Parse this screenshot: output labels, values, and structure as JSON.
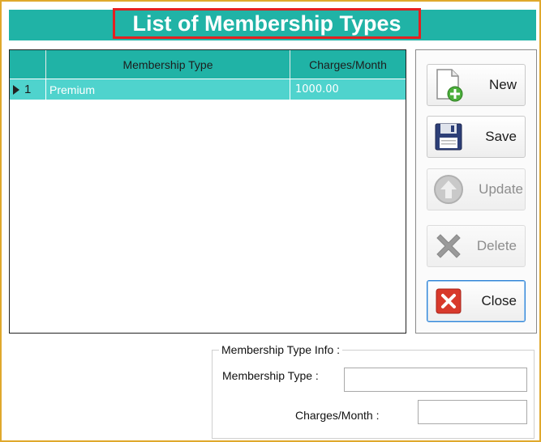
{
  "title": "List of Membership Types",
  "grid": {
    "columns": [
      "Membership Type",
      "Charges/Month"
    ],
    "rows": [
      {
        "index": "1",
        "membership_type": "Premium",
        "charges": "1000.00"
      }
    ]
  },
  "buttons": {
    "new": "New",
    "save": "Save",
    "update": "Update",
    "delete": "Delete",
    "close": "Close"
  },
  "info": {
    "legend": "Membership Type Info :",
    "type_label": "Membership Type :",
    "type_value": "",
    "charges_label": "Charges/Month :",
    "charges_value": ""
  },
  "colors": {
    "header_teal": "#20b3a6",
    "selected_row": "#4fd3cd",
    "title_border": "#e32020",
    "frame_border": "#e0a82c"
  }
}
